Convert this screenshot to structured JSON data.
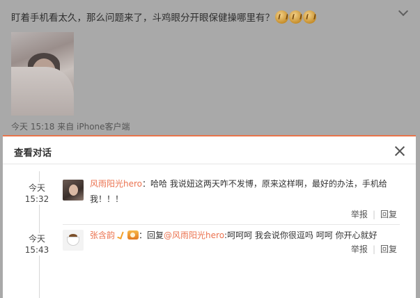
{
  "post": {
    "text": "盯着手机看太久，那么问题来了，斗鸡眼分开眼保健操哪里有？",
    "emoji_icons": [
      "laugh-emoji-icon",
      "laugh-emoji-icon",
      "laugh-emoji-icon"
    ],
    "meta": "今天 15:18 来自 iPhone客户端"
  },
  "dialog": {
    "title": "查看对话",
    "close_icon": "close-icon",
    "accent_color": "#e8734a",
    "comments": [
      {
        "date": "今天",
        "time": "15:32",
        "user": "风雨阳光hero",
        "text": "：哈哈 我说妞这两天咋不发博，原来这样啊，最好的办法，手机给我！！！",
        "report": "举报",
        "reply": "回复"
      },
      {
        "date": "今天",
        "time": "15:43",
        "user": "张含韵",
        "badges": [
          "verified-icon",
          "medal-icon"
        ],
        "reply_prefix": "：回复",
        "mention": "@风雨阳光hero",
        "text": ":呵呵呵 我会说你很逗吗 呵呵 你开心就好",
        "report": "举报",
        "reply": "回复"
      }
    ]
  }
}
